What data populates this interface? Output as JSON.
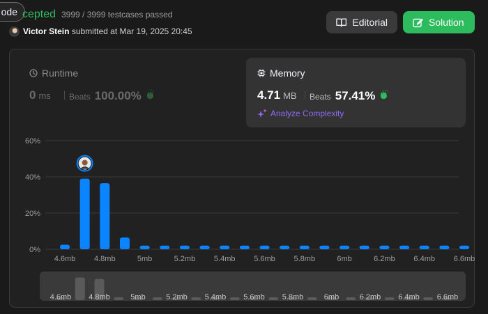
{
  "header": {
    "code_tab_label": "ode",
    "status": "cepted",
    "testcases": "3999 / 3999 testcases passed",
    "submitter_name": "Victor Stein",
    "submitted_text": "submitted at Mar 19, 2025 20:45",
    "editorial_label": "Editorial",
    "solution_label": "Solution"
  },
  "runtime": {
    "title": "Runtime",
    "value": "0",
    "unit": "ms",
    "beats_label": "Beats",
    "beats_pct": "100.00%"
  },
  "memory": {
    "title": "Memory",
    "value": "4.71",
    "unit": "MB",
    "beats_label": "Beats",
    "beats_pct": "57.41%",
    "analyze_label": "Analyze Complexity"
  },
  "colors": {
    "accent_green": "#2cbb5d",
    "bar_blue": "#0a84ff",
    "analyze_purple": "#8f6cf5",
    "amber": "#ffa116"
  },
  "chart_data": {
    "type": "bar",
    "title": "",
    "xlabel": "",
    "ylabel": "",
    "ylim": [
      0,
      60
    ],
    "y_ticks": [
      "0%",
      "20%",
      "40%",
      "60%"
    ],
    "x_tick_labels": [
      "4.6mb",
      "4.8mb",
      "5mb",
      "5.2mb",
      "5.4mb",
      "5.6mb",
      "5.8mb",
      "6mb",
      "6.2mb",
      "6.4mb",
      "6.6mb"
    ],
    "bin_width_mb": 0.1,
    "x_start_mb": 4.6,
    "values": [
      2.5,
      39,
      36.5,
      6.5,
      2,
      2,
      2,
      2,
      2,
      2,
      2,
      2,
      2,
      2,
      2,
      2,
      2,
      2,
      2,
      2,
      2
    ],
    "highlight_index": 1,
    "grid": true,
    "minimap": {
      "values": [
        0.5,
        39,
        36.5,
        0.5,
        0.5,
        0.5,
        0.5,
        0.5,
        0.5,
        0.5,
        0.5,
        0.5,
        0.5,
        0.5,
        0.5,
        0.5,
        0.5,
        0.5,
        0.5,
        0.5,
        0.5
      ],
      "x_tick_labels": [
        "4.6mb",
        "4.8mb",
        "5mb",
        "5.2mb",
        "5.4mb",
        "5.6mb",
        "5.8mb",
        "6mb",
        "6.2mb",
        "6.4mb",
        "6.6mb"
      ]
    }
  }
}
